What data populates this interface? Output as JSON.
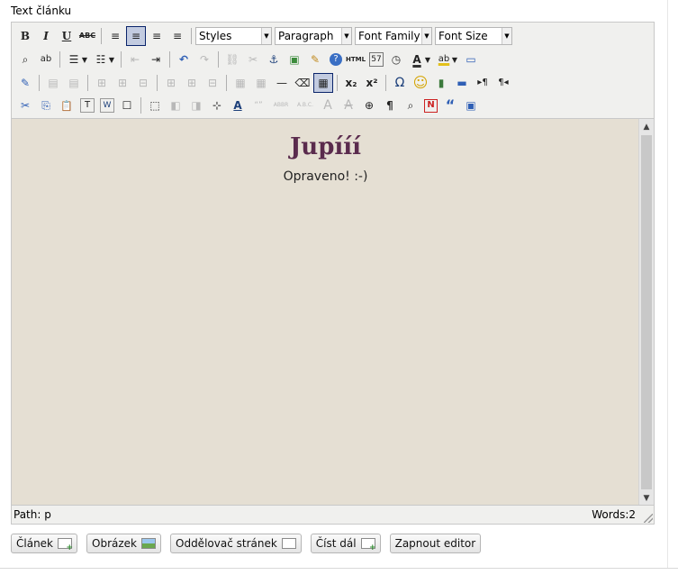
{
  "field_label": "Text článku",
  "toolbar": {
    "row1": {
      "bold": "B",
      "italic": "I",
      "underline": "U",
      "strikethrough": "ABC",
      "align_left": "≡",
      "align_center": "≡",
      "align_right": "≡",
      "align_justify": "≡",
      "styles": "Styles",
      "format": "Paragraph",
      "font_family": "Font Family",
      "font_size": "Font Size"
    },
    "row2": {
      "find": "⌕",
      "replace": "ab",
      "bullist": "☰",
      "numlist": "☷",
      "outdent": "⇤",
      "indent": "⇥",
      "undo": "↶",
      "redo": "↷",
      "link": "⛓",
      "unlink": "✂",
      "anchor": "⚓",
      "image": "▣",
      "cleanup": "✎",
      "help": "?",
      "html": "HTML",
      "insert_date": "57",
      "insert_time": "◷",
      "forecolor": "A",
      "backcolor": "ab",
      "fullscreen": "▭"
    },
    "row3": {
      "edit_css": "✎",
      "table_row_props": "▤",
      "table_cell_props": "▤",
      "row_before": "⊞",
      "row_after": "⊞",
      "delete_row": "⊟",
      "col_before": "⊞",
      "col_after": "⊞",
      "delete_col": "⊟",
      "split_cells": "▦",
      "merge_cells": "▦",
      "hr": "—",
      "remove_format": "⌫",
      "visual_aid": "▦",
      "subscript": "x₂",
      "superscript": "x²",
      "charmap": "Ω",
      "emotions": "☺",
      "media": "▮",
      "advhr": "▬",
      "ltr": "▸¶",
      "rtl": "¶◂"
    },
    "row4": {
      "cut": "✂",
      "copy": "⎘",
      "paste": "📋",
      "paste_text": "T",
      "paste_word": "W",
      "select_all": "☐",
      "insert_layer": "⬚",
      "move_forward": "◧",
      "move_backward": "◨",
      "absolute": "⊹",
      "styleprops": "A",
      "cite": "“”",
      "abbr": "ABBR",
      "acronym": "A.B.C.",
      "del": "A",
      "ins": "A",
      "attribs": "⊕",
      "visualchars": "¶",
      "preview": "⌕",
      "nonbreaking": "N",
      "blockquote": "“",
      "template": "▣"
    }
  },
  "content": {
    "title": "Jupííí",
    "paragraph": "Opraveno! :-)"
  },
  "status": {
    "path": "Path: p",
    "words": "Words:2"
  },
  "insert_buttons": {
    "clanek": "Článek",
    "obrazek": "Obrázek",
    "oddelovac": "Oddělovač stránek",
    "cist_dal": "Číst dál",
    "zapnout": "Zapnout editor"
  }
}
